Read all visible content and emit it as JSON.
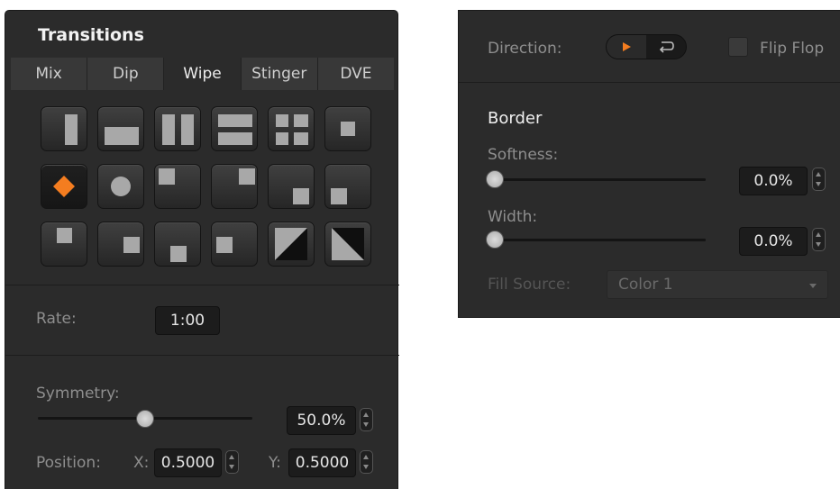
{
  "transitions": {
    "title": "Transitions",
    "tabs": [
      {
        "label": "Mix"
      },
      {
        "label": "Dip"
      },
      {
        "label": "Wipe"
      },
      {
        "label": "Stinger"
      },
      {
        "label": "DVE"
      }
    ],
    "active_tab": "Wipe",
    "wipe_patterns": {
      "selected": "diamond",
      "accent_color": "#f47d20"
    },
    "rate": {
      "label": "Rate:",
      "value": "1:00"
    },
    "symmetry": {
      "label": "Symmetry:",
      "value": "50.0%",
      "level": 0.5
    },
    "position": {
      "label": "Position:",
      "x_label": "X:",
      "x_value": "0.5000",
      "y_label": "Y:",
      "y_value": "0.5000"
    }
  },
  "border_panel": {
    "direction": {
      "label": "Direction:",
      "forward_icon": "play-icon",
      "reverse_icon": "return-arrow-icon"
    },
    "flip_flop": {
      "label": "Flip Flop",
      "checked": false
    },
    "border_title": "Border",
    "softness": {
      "label": "Softness:",
      "value": "0.0%",
      "level": 0
    },
    "width": {
      "label": "Width:",
      "value": "0.0%",
      "level": 0
    },
    "fill_source": {
      "label": "Fill Source:",
      "value": "Color 1",
      "enabled": false
    }
  }
}
